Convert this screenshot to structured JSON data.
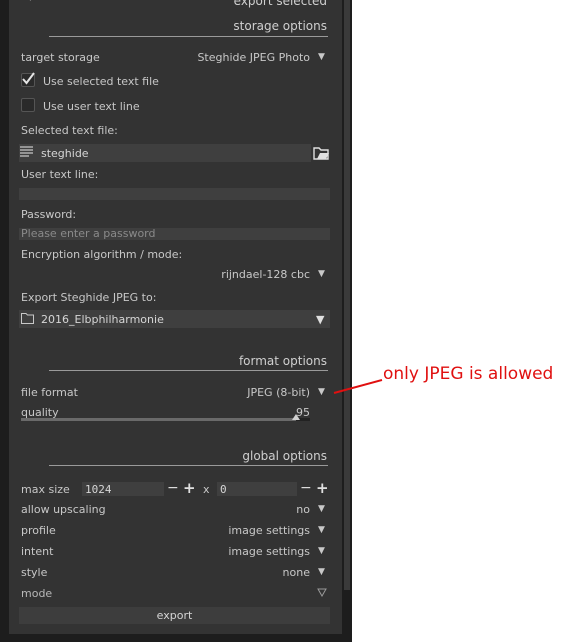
{
  "header": {
    "title_partial": "export selected"
  },
  "storage": {
    "section_title": "storage options",
    "target_storage_label": "target storage",
    "target_storage_value": "Steghide JPEG Photo",
    "use_text_file_label": "Use selected text file",
    "use_text_file_checked": true,
    "use_text_line_label": "Use user text line",
    "use_text_line_checked": false,
    "selected_text_file_label": "Selected text file:",
    "selected_text_file_value": "steghide",
    "user_text_line_label": "User text line:",
    "user_text_line_value": "",
    "password_label": "Password:",
    "password_placeholder": "Please enter a password",
    "encryption_label": "Encryption algorithm / mode:",
    "encryption_value": "rijndael-128 cbc",
    "export_to_label": "Export Steghide JPEG to:",
    "export_to_value": "2016_Elbphilharmonie"
  },
  "format": {
    "section_title": "format options",
    "file_format_label": "file format",
    "file_format_value": "JPEG (8-bit)",
    "quality_label": "quality",
    "quality_value": "95",
    "quality_fraction": 0.95
  },
  "global": {
    "section_title": "global options",
    "max_size_label": "max size",
    "max_width": "1024",
    "times": "x",
    "max_height": "0",
    "upscaling_label": "allow upscaling",
    "upscaling_value": "no",
    "profile_label": "profile",
    "profile_value": "image settings",
    "intent_label": "intent",
    "intent_value": "image settings",
    "style_label": "style",
    "style_value": "none",
    "mode_label": "mode"
  },
  "export_button": "export",
  "annotation": {
    "text": "only JPEG is allowed",
    "color": "#e01010"
  },
  "icons": {
    "dropdown": "▼",
    "plus": "+",
    "minus": "−"
  }
}
